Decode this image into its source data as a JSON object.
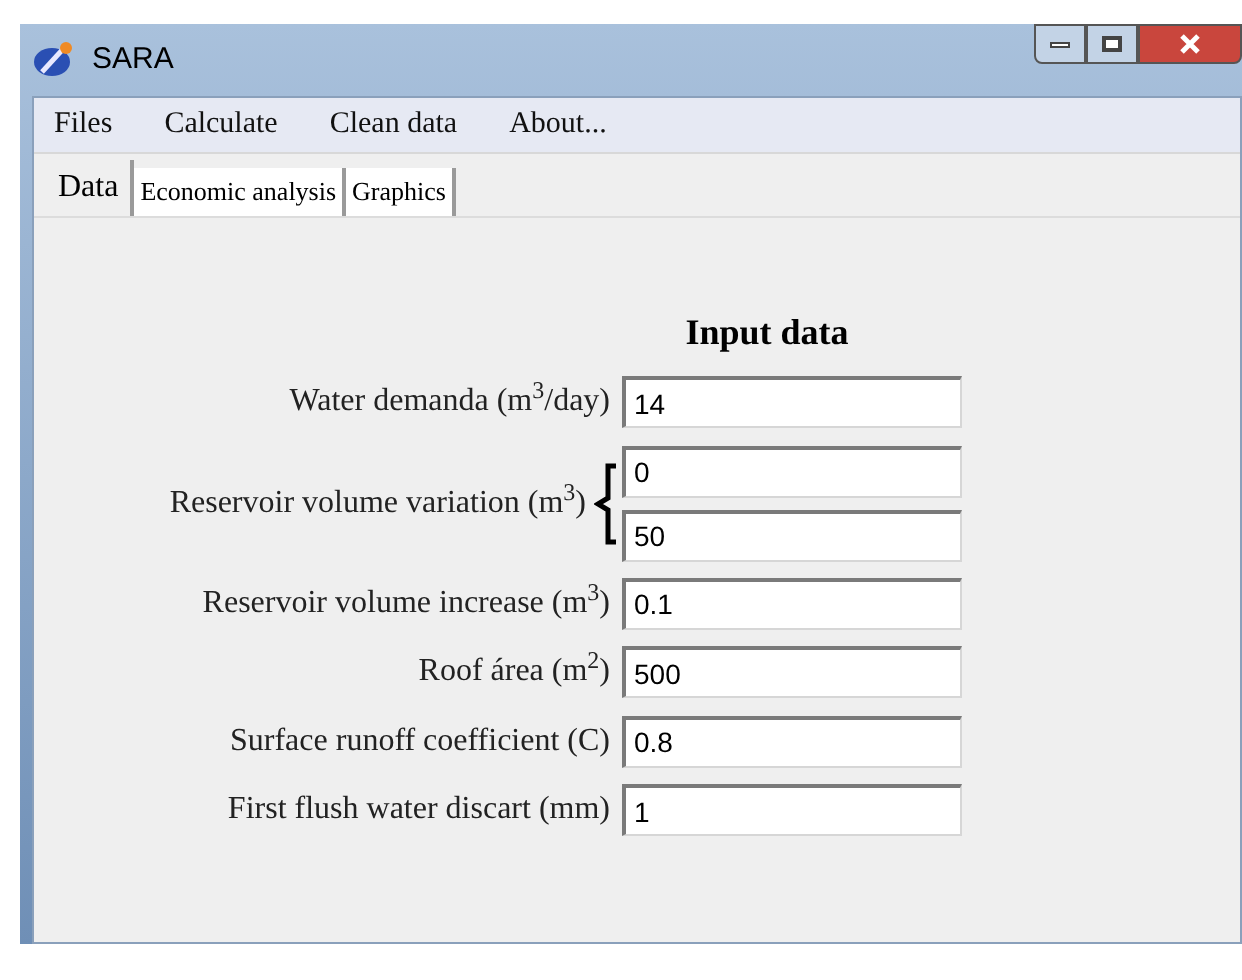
{
  "window": {
    "title": "SARA"
  },
  "menu": [
    "Files",
    "Calculate",
    "Clean data",
    "About..."
  ],
  "tabs": [
    {
      "label": "Data",
      "selected": true
    },
    {
      "label": "Economic analysis",
      "selected": false
    },
    {
      "label": "Graphics",
      "selected": false
    }
  ],
  "heading": "Input data",
  "fields": [
    {
      "kind": "single",
      "label": "Water demanda (m$^{3}$/day)",
      "values": [
        "14"
      ]
    },
    {
      "kind": "range",
      "label": "Reservoir volume variation (m$^{3}$)",
      "values": [
        "0",
        "50"
      ]
    },
    {
      "kind": "single",
      "label": "Reservoir volume increase (m$^{3}$)",
      "values": [
        "0.1"
      ]
    },
    {
      "kind": "single",
      "label": "Roof área (m$^{2}$)",
      "values": [
        "500"
      ]
    },
    {
      "kind": "single",
      "label": "Surface runoff coefficient (C)",
      "values": [
        "0.8"
      ]
    },
    {
      "kind": "single",
      "label": "First flush water discart (mm)",
      "values": [
        "1"
      ]
    }
  ]
}
